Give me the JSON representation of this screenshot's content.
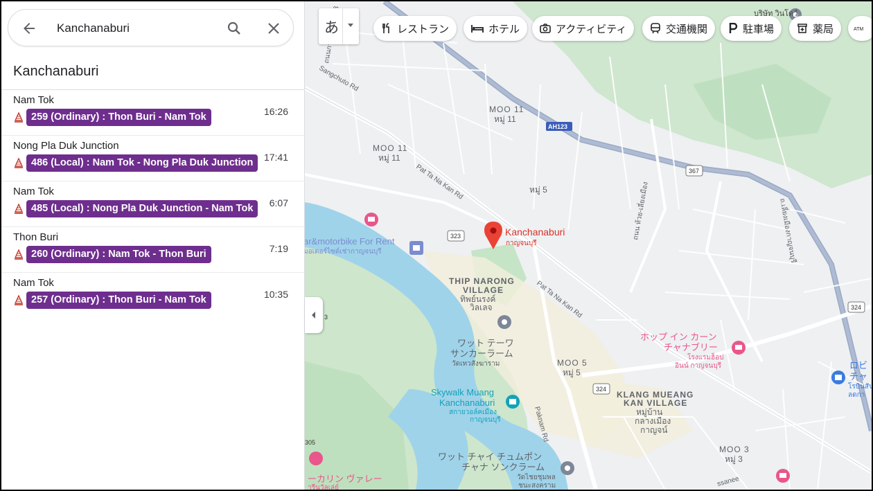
{
  "search": {
    "query": "Kanchanaburi",
    "back_icon": "arrow-back-icon",
    "search_icon": "search-icon",
    "close_icon": "close-icon"
  },
  "panel": {
    "title": "Kanchanaburi"
  },
  "departures": [
    {
      "destination": "Nam Tok",
      "route": "259 (Ordinary) : Thon Buri - Nam Tok",
      "time": "16:26"
    },
    {
      "destination": "Nong Pla Duk Junction",
      "route": "486 (Local) : Nam Tok - Nong Pla Duk Junction",
      "time": "17:41"
    },
    {
      "destination": "Nam Tok",
      "route": "485 (Local) : Nong Pla Duk Junction - Nam Tok",
      "time": "6:07"
    },
    {
      "destination": "Thon Buri",
      "route": "260 (Ordinary) : Nam Tok - Thon Buri",
      "time": "7:19"
    },
    {
      "destination": "Nam Tok",
      "route": "257 (Ordinary) : Thon Buri - Nam Tok",
      "time": "10:35"
    }
  ],
  "route_badge_color": "#6e2e8e",
  "language_toggle": {
    "char": "あ"
  },
  "categories": [
    {
      "label": "レストラン",
      "icon": "restaurant-icon"
    },
    {
      "label": "ホテル",
      "icon": "hotel-icon"
    },
    {
      "label": "アクティビティ",
      "icon": "camera-icon"
    },
    {
      "label": "交通機関",
      "icon": "train-icon"
    },
    {
      "label": "駐車場",
      "icon": "parking-icon"
    },
    {
      "label": "薬局",
      "icon": "pharmacy-icon"
    }
  ],
  "map": {
    "pin": {
      "name": "Kanchanaburi",
      "name_th": "กาญจนบุรี"
    },
    "labels": {
      "moo11a": "MOO 11",
      "moo11a_th": "หมู่ 11",
      "moo11b": "MOO 11",
      "moo11b_th": "หมู่ 11",
      "mu5": "หมู่ 5",
      "thip1": "THIP NARONG",
      "thip2": "VILLAGE",
      "thip_th1": "ทิพย์นรงค์",
      "thip_th2": "วิลเลจ",
      "moo5": "MOO 5",
      "moo5_th": "หมู่ 5",
      "klang1": "KLANG MUEANG",
      "klang2": "KAN VILLAGE",
      "klang_th1": "หมู่บ้าน",
      "klang_th2": "กลางเมือง",
      "klang_th3": "กาญจน์",
      "moo3": "MOO 3",
      "moo3_th": "หมู่ 3",
      "watdeva1": "ワット テーワ",
      "watdeva2": "サンカーラーム",
      "watdeva_th": "วัดเทวสังฆาราม",
      "skywalk1": "Skywalk Muang",
      "skywalk2": "Kanchanaburi",
      "skywalk_th1": "สกายวอล์คเมือง",
      "skywalk_th2": "กาญจนบุรี",
      "watchai1": "ワット チャイ チュムポン",
      "watchai2": "チャナ ソンクラーム",
      "watchai_th1": "วัดไชยชุมพล",
      "watchai_th2": "ชนะสงคราม",
      "hop1": "ホップ イン カーン",
      "hop2": "チャナブリー",
      "hop_th1": "โรงแรมฮ็อป",
      "hop_th2": "อินน์ กาญจนบุรี",
      "karin": "ーカリン ヴァレー",
      "karin_th": "ารีนวัลเล่ย์",
      "bike1": "ar&motorbike For Rent",
      "bike_th": "มอเตอร์ไซด์เช่ากาญจนบุรี",
      "topright": "บริษัท วินโดว์",
      "right1": "ロビ",
      "right2": "チャ",
      "right_th1": "โรบินสัน",
      "right_th2": "ลดกา",
      "rd_sangchuto": "Sangchuto Rd",
      "rd_pattanakan1": "Pat Ta Na Kan Rd",
      "rd_pattanakan2": "Pat Ta Na Kan Rd",
      "rd_paknam": "Paknam Rd",
      "rd_th1": "ถนน ห้วย-เลี่ยงเมือง",
      "rd_th2": "ถ.เลี่ยงเมืองกาญจนบุรี",
      "rd_th3": "ถนนกาญจนบุรี 323",
      "shield_ah123": "AH123",
      "shield_367": "367",
      "shield_323": "323",
      "shield_324a": "324",
      "shield_324b": "324",
      "shield_3": "3",
      "shield_305": "305",
      "rd_sanee": "ssanee"
    }
  }
}
